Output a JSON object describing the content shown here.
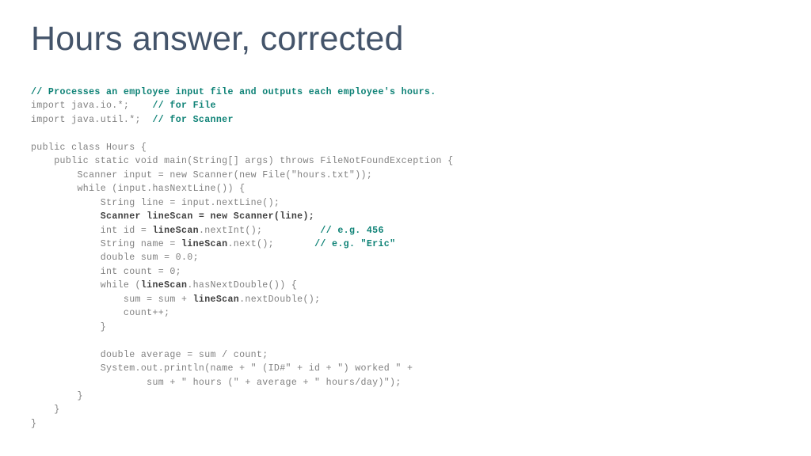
{
  "slide": {
    "title": "Hours answer, corrected",
    "title_color": "#44546a",
    "background_color": "#ffffff",
    "code_color": "#808080",
    "comment_color": "#0e8276",
    "emphasis_color": "#3f3f3f"
  },
  "code": {
    "language": "java",
    "lines": [
      {
        "id": "line-1",
        "segments": [
          {
            "text": "// Processes an employee input file and outputs each employee's hours.",
            "style": "comment"
          }
        ]
      },
      {
        "id": "line-2",
        "segments": [
          {
            "text": "import java.io.*;    ",
            "style": "plain"
          },
          {
            "text": "// for File",
            "style": "comment"
          }
        ]
      },
      {
        "id": "line-3",
        "segments": [
          {
            "text": "import java.util.*;  ",
            "style": "plain"
          },
          {
            "text": "// for Scanner",
            "style": "comment"
          }
        ]
      },
      {
        "id": "line-4",
        "segments": [
          {
            "text": "",
            "style": "plain"
          }
        ]
      },
      {
        "id": "line-5",
        "segments": [
          {
            "text": "public class Hours {",
            "style": "plain"
          }
        ]
      },
      {
        "id": "line-6",
        "segments": [
          {
            "text": "    public static void main(String[] args) throws FileNotFoundException {",
            "style": "plain"
          }
        ]
      },
      {
        "id": "line-7",
        "segments": [
          {
            "text": "        Scanner input = new Scanner(new File(\"hours.txt\"));",
            "style": "plain"
          }
        ]
      },
      {
        "id": "line-8",
        "segments": [
          {
            "text": "        while (input.hasNextLine()) {",
            "style": "plain"
          }
        ]
      },
      {
        "id": "line-9",
        "segments": [
          {
            "text": "            String line = input.nextLine();",
            "style": "plain"
          }
        ]
      },
      {
        "id": "line-10",
        "segments": [
          {
            "text": "            ",
            "style": "plain"
          },
          {
            "text": "Scanner lineScan = new Scanner(line);",
            "style": "strong"
          }
        ]
      },
      {
        "id": "line-11",
        "segments": [
          {
            "text": "            int id = ",
            "style": "plain"
          },
          {
            "text": "lineScan",
            "style": "strong"
          },
          {
            "text": ".nextInt();          ",
            "style": "plain"
          },
          {
            "text": "// e.g. 456",
            "style": "comment"
          }
        ]
      },
      {
        "id": "line-12",
        "segments": [
          {
            "text": "            String name = ",
            "style": "plain"
          },
          {
            "text": "lineScan",
            "style": "strong"
          },
          {
            "text": ".next();       ",
            "style": "plain"
          },
          {
            "text": "// e.g. \"Eric\"",
            "style": "comment"
          }
        ]
      },
      {
        "id": "line-13",
        "segments": [
          {
            "text": "            double sum = 0.0;",
            "style": "plain"
          }
        ]
      },
      {
        "id": "line-14",
        "segments": [
          {
            "text": "            int count = 0;",
            "style": "plain"
          }
        ]
      },
      {
        "id": "line-15",
        "segments": [
          {
            "text": "            while (",
            "style": "plain"
          },
          {
            "text": "lineScan",
            "style": "strong"
          },
          {
            "text": ".hasNextDouble()) {",
            "style": "plain"
          }
        ]
      },
      {
        "id": "line-16",
        "segments": [
          {
            "text": "                sum = sum + ",
            "style": "plain"
          },
          {
            "text": "lineScan",
            "style": "strong"
          },
          {
            "text": ".nextDouble();",
            "style": "plain"
          }
        ]
      },
      {
        "id": "line-17",
        "segments": [
          {
            "text": "                count++;",
            "style": "plain"
          }
        ]
      },
      {
        "id": "line-18",
        "segments": [
          {
            "text": "            }",
            "style": "plain"
          }
        ]
      },
      {
        "id": "line-19",
        "segments": [
          {
            "text": "",
            "style": "plain"
          }
        ]
      },
      {
        "id": "line-20",
        "segments": [
          {
            "text": "            double average = sum / count;",
            "style": "plain"
          }
        ]
      },
      {
        "id": "line-21",
        "segments": [
          {
            "text": "            System.out.println(name + \" (ID#\" + id + \") worked \" +",
            "style": "plain"
          }
        ]
      },
      {
        "id": "line-22",
        "segments": [
          {
            "text": "                    sum + \" hours (\" + average + \" hours/day)\");",
            "style": "plain"
          }
        ]
      },
      {
        "id": "line-23",
        "segments": [
          {
            "text": "        }",
            "style": "plain"
          }
        ]
      },
      {
        "id": "line-24",
        "segments": [
          {
            "text": "    }",
            "style": "plain"
          }
        ]
      },
      {
        "id": "line-25",
        "segments": [
          {
            "text": "}",
            "style": "plain"
          }
        ]
      }
    ]
  }
}
